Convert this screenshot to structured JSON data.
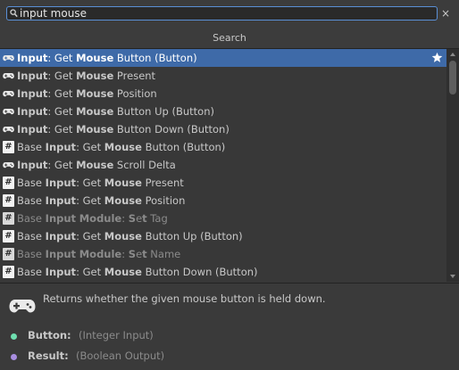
{
  "search": {
    "value": "input mouse",
    "clear": "×"
  },
  "header": {
    "title": "Search"
  },
  "results": [
    {
      "parts": [
        [
          "Input",
          true
        ],
        [
          ": Get ",
          false
        ],
        [
          "Mouse",
          true
        ],
        [
          " Button (Button)",
          false
        ]
      ],
      "icon": "gamepad-icon",
      "selected": true,
      "starred": true,
      "dim": false
    },
    {
      "parts": [
        [
          "Input",
          true
        ],
        [
          ": Get ",
          false
        ],
        [
          "Mouse",
          true
        ],
        [
          " Present",
          false
        ]
      ],
      "icon": "gamepad-icon",
      "selected": false,
      "dim": false
    },
    {
      "parts": [
        [
          "Input",
          true
        ],
        [
          ": Get ",
          false
        ],
        [
          "Mouse",
          true
        ],
        [
          " Position",
          false
        ]
      ],
      "icon": "gamepad-icon",
      "selected": false,
      "dim": false
    },
    {
      "parts": [
        [
          "Input",
          true
        ],
        [
          ": Get ",
          false
        ],
        [
          "Mouse",
          true
        ],
        [
          " Button Up (Button)",
          false
        ]
      ],
      "icon": "gamepad-icon",
      "selected": false,
      "dim": false
    },
    {
      "parts": [
        [
          "Input",
          true
        ],
        [
          ": Get ",
          false
        ],
        [
          "Mouse",
          true
        ],
        [
          " Button Down (Button)",
          false
        ]
      ],
      "icon": "gamepad-icon",
      "selected": false,
      "dim": false
    },
    {
      "parts": [
        [
          "Base ",
          false
        ],
        [
          "Input",
          true
        ],
        [
          ": Get ",
          false
        ],
        [
          "Mouse",
          true
        ],
        [
          " Button (Button)",
          false
        ]
      ],
      "icon": "script-hash-icon",
      "selected": false,
      "dim": false
    },
    {
      "parts": [
        [
          "Input",
          true
        ],
        [
          ": Get ",
          false
        ],
        [
          "Mouse",
          true
        ],
        [
          " Scroll Delta",
          false
        ]
      ],
      "icon": "gamepad-icon",
      "selected": false,
      "dim": false
    },
    {
      "parts": [
        [
          "Base ",
          false
        ],
        [
          "Input",
          true
        ],
        [
          ": Get ",
          false
        ],
        [
          "Mouse",
          true
        ],
        [
          " Present",
          false
        ]
      ],
      "icon": "script-hash-icon",
      "selected": false,
      "dim": false
    },
    {
      "parts": [
        [
          "Base ",
          false
        ],
        [
          "Input",
          true
        ],
        [
          ": Get ",
          false
        ],
        [
          "Mouse",
          true
        ],
        [
          " Position",
          false
        ]
      ],
      "icon": "script-hash-icon",
      "selected": false,
      "dim": false
    },
    {
      "parts": [
        [
          "Base ",
          false
        ],
        [
          "Input",
          true
        ],
        [
          " ",
          false
        ],
        [
          "Module",
          true
        ],
        [
          ": ",
          false
        ],
        [
          "S",
          true
        ],
        [
          "e",
          false
        ],
        [
          "t",
          true
        ],
        [
          " Tag",
          false
        ]
      ],
      "icon": "script-hash-icon",
      "selected": false,
      "dim": true
    },
    {
      "parts": [
        [
          "Base ",
          false
        ],
        [
          "Input",
          true
        ],
        [
          ": Get ",
          false
        ],
        [
          "Mouse",
          true
        ],
        [
          " Button Up (Button)",
          false
        ]
      ],
      "icon": "script-hash-icon",
      "selected": false,
      "dim": false
    },
    {
      "parts": [
        [
          "Base ",
          false
        ],
        [
          "Input",
          true
        ],
        [
          " ",
          false
        ],
        [
          "Module",
          true
        ],
        [
          ": ",
          false
        ],
        [
          "S",
          true
        ],
        [
          "e",
          false
        ],
        [
          "t",
          true
        ],
        [
          " Name",
          false
        ]
      ],
      "icon": "script-hash-icon",
      "selected": false,
      "dim": true
    },
    {
      "parts": [
        [
          "Base ",
          false
        ],
        [
          "Input",
          true
        ],
        [
          ": Get ",
          false
        ],
        [
          "Mouse",
          true
        ],
        [
          " Button Down (Button)",
          false
        ]
      ],
      "icon": "script-hash-icon",
      "selected": false,
      "dim": false
    }
  ],
  "details": {
    "description": "Returns whether the given mouse button is held down.",
    "ports": [
      {
        "name": "Button:",
        "type": "(Integer Input)",
        "color": "#6fdfb0"
      },
      {
        "name": "Result:",
        "type": "(Boolean Output)",
        "color": "#a98ee0"
      }
    ]
  },
  "colors": {
    "accent": "#3e6aa8",
    "search_border": "#5a8fd6"
  }
}
